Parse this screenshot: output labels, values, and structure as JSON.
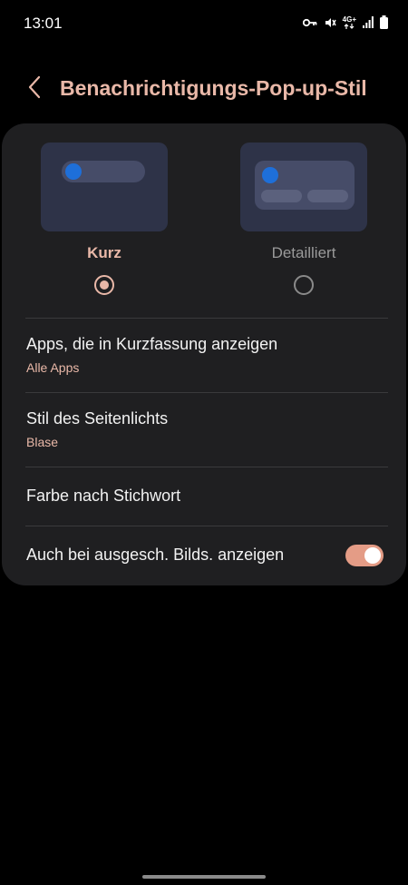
{
  "status_bar": {
    "time": "13:01",
    "network": "4G+",
    "icons": [
      "key-icon",
      "vibrate-mute-icon",
      "network-icon",
      "signal-icon",
      "battery-icon"
    ]
  },
  "header": {
    "back_icon": "chevron-left-icon",
    "title": "Benachrichtigungs-Pop-up-Stil"
  },
  "style_options": [
    {
      "label": "Kurz",
      "selected": true
    },
    {
      "label": "Detailliert",
      "selected": false
    }
  ],
  "settings": [
    {
      "title": "Apps, die in Kurzfassung anzeigen",
      "subtitle": "Alle Apps"
    },
    {
      "title": "Stil des Seitenlichts",
      "subtitle": "Blase"
    },
    {
      "title": "Farbe nach Stichwort"
    },
    {
      "title": "Auch bei ausgesch. Bilds. anzeigen",
      "toggle_on": true
    }
  ],
  "colors": {
    "accent": "#e9b8a8",
    "toggle_on": "#e49c86",
    "card_bg": "#1f1f21",
    "preview_bg": "#2e3348",
    "preview_dot": "#1e6fd9"
  }
}
